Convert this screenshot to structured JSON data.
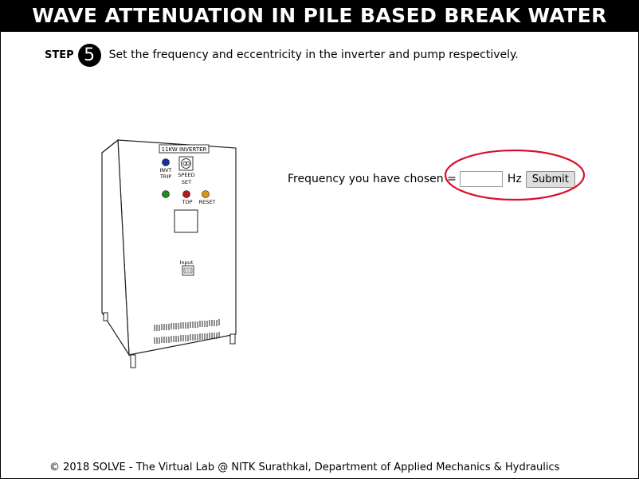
{
  "header": {
    "title": "WAVE ATTENUATION IN PILE BASED BREAK WATER"
  },
  "step": {
    "word": "STEP",
    "number": "5",
    "instruction": "Set the frequency and eccentricity in the inverter and pump respectively."
  },
  "inverter": {
    "nameplate": "11KW INVERTER",
    "invt_trip_label_1": "INVT",
    "invt_trip_label_2": "TRIP",
    "speed_label_1": "SPEED",
    "speed_label_2": "SET",
    "top_label": "TOP",
    "reset_label": "RESET",
    "input_label": "Input",
    "colors": {
      "trip_lamp": "#1a2f9a",
      "green_lamp": "#1f8a1f",
      "red_lamp": "#b81818",
      "amber_lamp": "#d9950f"
    }
  },
  "frequency_form": {
    "label": "Frequency you have chosen =",
    "value": "",
    "unit": "Hz",
    "submit_label": "Submit"
  },
  "highlight_color": "#d9102a",
  "footer": {
    "text": "© 2018 SOLVE - The Virtual Lab @ NITK Surathkal, Department of Applied Mechanics & Hydraulics"
  }
}
